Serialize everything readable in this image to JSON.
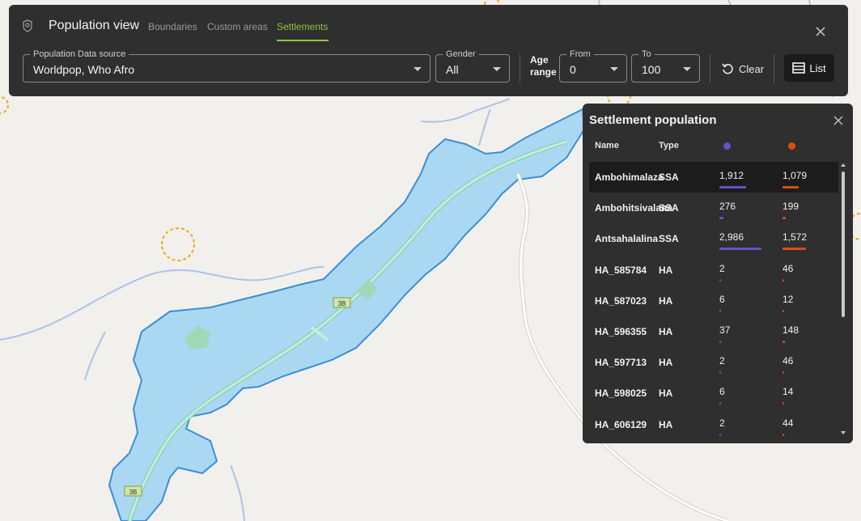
{
  "header": {
    "title": "Population view",
    "tabs": [
      {
        "label": "Boundaries",
        "active": false
      },
      {
        "label": "Custom areas",
        "active": false
      },
      {
        "label": "Settlements",
        "active": true
      }
    ]
  },
  "filters": {
    "source": {
      "label": "Population Data source",
      "value": "Worldpop, Who Afro"
    },
    "gender": {
      "label": "Gender",
      "value": "All"
    },
    "age_range_label": "Age range",
    "from": {
      "label": "From",
      "value": "0"
    },
    "to": {
      "label": "To",
      "value": "100"
    },
    "clear_label": "Clear",
    "list_label": "List"
  },
  "map": {
    "road_labels": [
      "3B",
      "3B"
    ]
  },
  "panel": {
    "title": "Settlement population",
    "columns": {
      "name": "Name",
      "type": "Type"
    },
    "series_colors": {
      "a": "#6a4fc4",
      "b": "#e04a12"
    },
    "max_values": {
      "a": 2986,
      "b": 1572
    },
    "rows": [
      {
        "name": "Ambohimalaza",
        "type": "SSA",
        "v1": "1,912",
        "v2": "1,079",
        "n1": 1912,
        "n2": 1079
      },
      {
        "name": "Ambohitsivalana",
        "type": "SSA",
        "v1": "276",
        "v2": "199",
        "n1": 276,
        "n2": 199
      },
      {
        "name": "Antsahalalina",
        "type": "SSA",
        "v1": "2,986",
        "v2": "1,572",
        "n1": 2986,
        "n2": 1572
      },
      {
        "name": "HA_585784",
        "type": "HA",
        "v1": "2",
        "v2": "46",
        "n1": 2,
        "n2": 46
      },
      {
        "name": "HA_587023",
        "type": "HA",
        "v1": "6",
        "v2": "12",
        "n1": 6,
        "n2": 12
      },
      {
        "name": "HA_596355",
        "type": "HA",
        "v1": "37",
        "v2": "148",
        "n1": 37,
        "n2": 148
      },
      {
        "name": "HA_597713",
        "type": "HA",
        "v1": "2",
        "v2": "46",
        "n1": 2,
        "n2": 46
      },
      {
        "name": "HA_598025",
        "type": "HA",
        "v1": "6",
        "v2": "14",
        "n1": 6,
        "n2": 14
      },
      {
        "name": "HA_606129",
        "type": "HA",
        "v1": "2",
        "v2": "44",
        "n1": 2,
        "n2": 44
      }
    ]
  }
}
